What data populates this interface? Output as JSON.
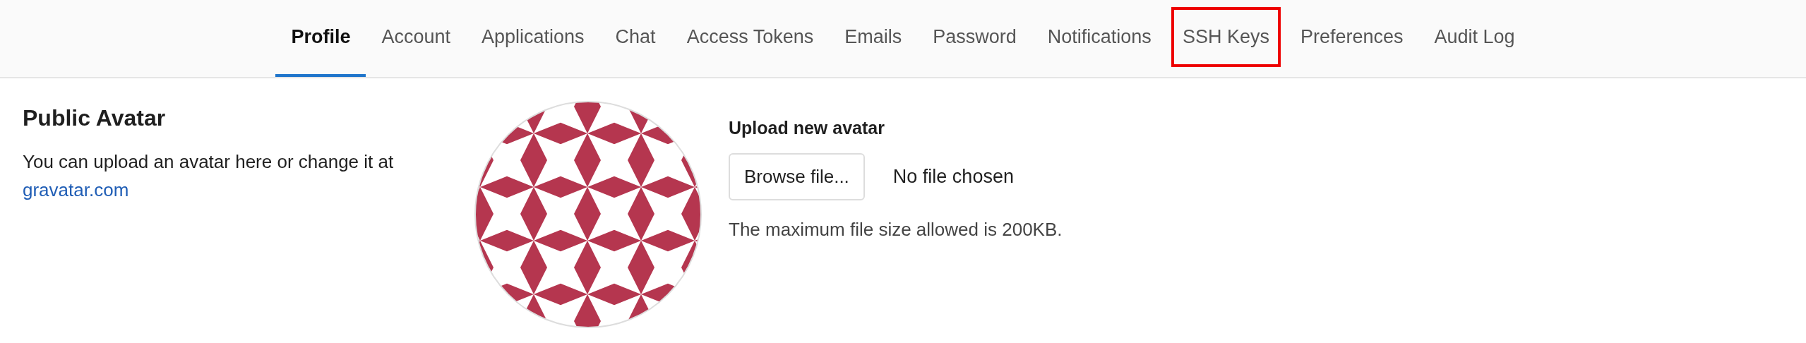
{
  "tabs": [
    {
      "label": "Profile",
      "selected": true,
      "highlighted": false
    },
    {
      "label": "Account",
      "selected": false,
      "highlighted": false
    },
    {
      "label": "Applications",
      "selected": false,
      "highlighted": false
    },
    {
      "label": "Chat",
      "selected": false,
      "highlighted": false
    },
    {
      "label": "Access Tokens",
      "selected": false,
      "highlighted": false
    },
    {
      "label": "Emails",
      "selected": false,
      "highlighted": false
    },
    {
      "label": "Password",
      "selected": false,
      "highlighted": false
    },
    {
      "label": "Notifications",
      "selected": false,
      "highlighted": false
    },
    {
      "label": "SSH Keys",
      "selected": false,
      "highlighted": true
    },
    {
      "label": "Preferences",
      "selected": false,
      "highlighted": false
    },
    {
      "label": "Audit Log",
      "selected": false,
      "highlighted": false
    }
  ],
  "section": {
    "title": "Public Avatar",
    "description": "You can upload an avatar here or change it at",
    "link": "gravatar.com"
  },
  "upload": {
    "title": "Upload new avatar",
    "button": "Browse file...",
    "status": "No file chosen",
    "help": "The maximum file size allowed is 200KB."
  }
}
